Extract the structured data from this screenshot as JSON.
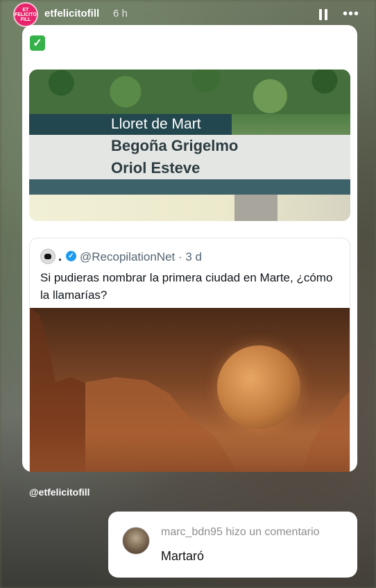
{
  "header": {
    "avatar_text": "ET FELICITO FILL",
    "username": "etfelicitofill",
    "time": "6 h",
    "pause_icon": "pause-icon",
    "more_icon": "more-icon"
  },
  "post": {
    "check_icon": "✅",
    "tv_caption": {
      "place": "Lloret de Mart",
      "names": [
        "Begoña Grigelmo",
        "Oriol Esteve"
      ]
    },
    "tweet": {
      "separator": ".",
      "handle": "@RecopilationNet · 3 d",
      "text": "Si pudieras nombrar la primera ciudad en Marte, ¿cómo la llamarías?"
    }
  },
  "mention": "@etfelicitofill",
  "comment": {
    "title": "marc_bdn95 hizo un comentario",
    "text": "Martaró"
  },
  "colors": {
    "avatar": "#e8246b",
    "verified": "#1d9bf0",
    "check": "#35b24a"
  }
}
